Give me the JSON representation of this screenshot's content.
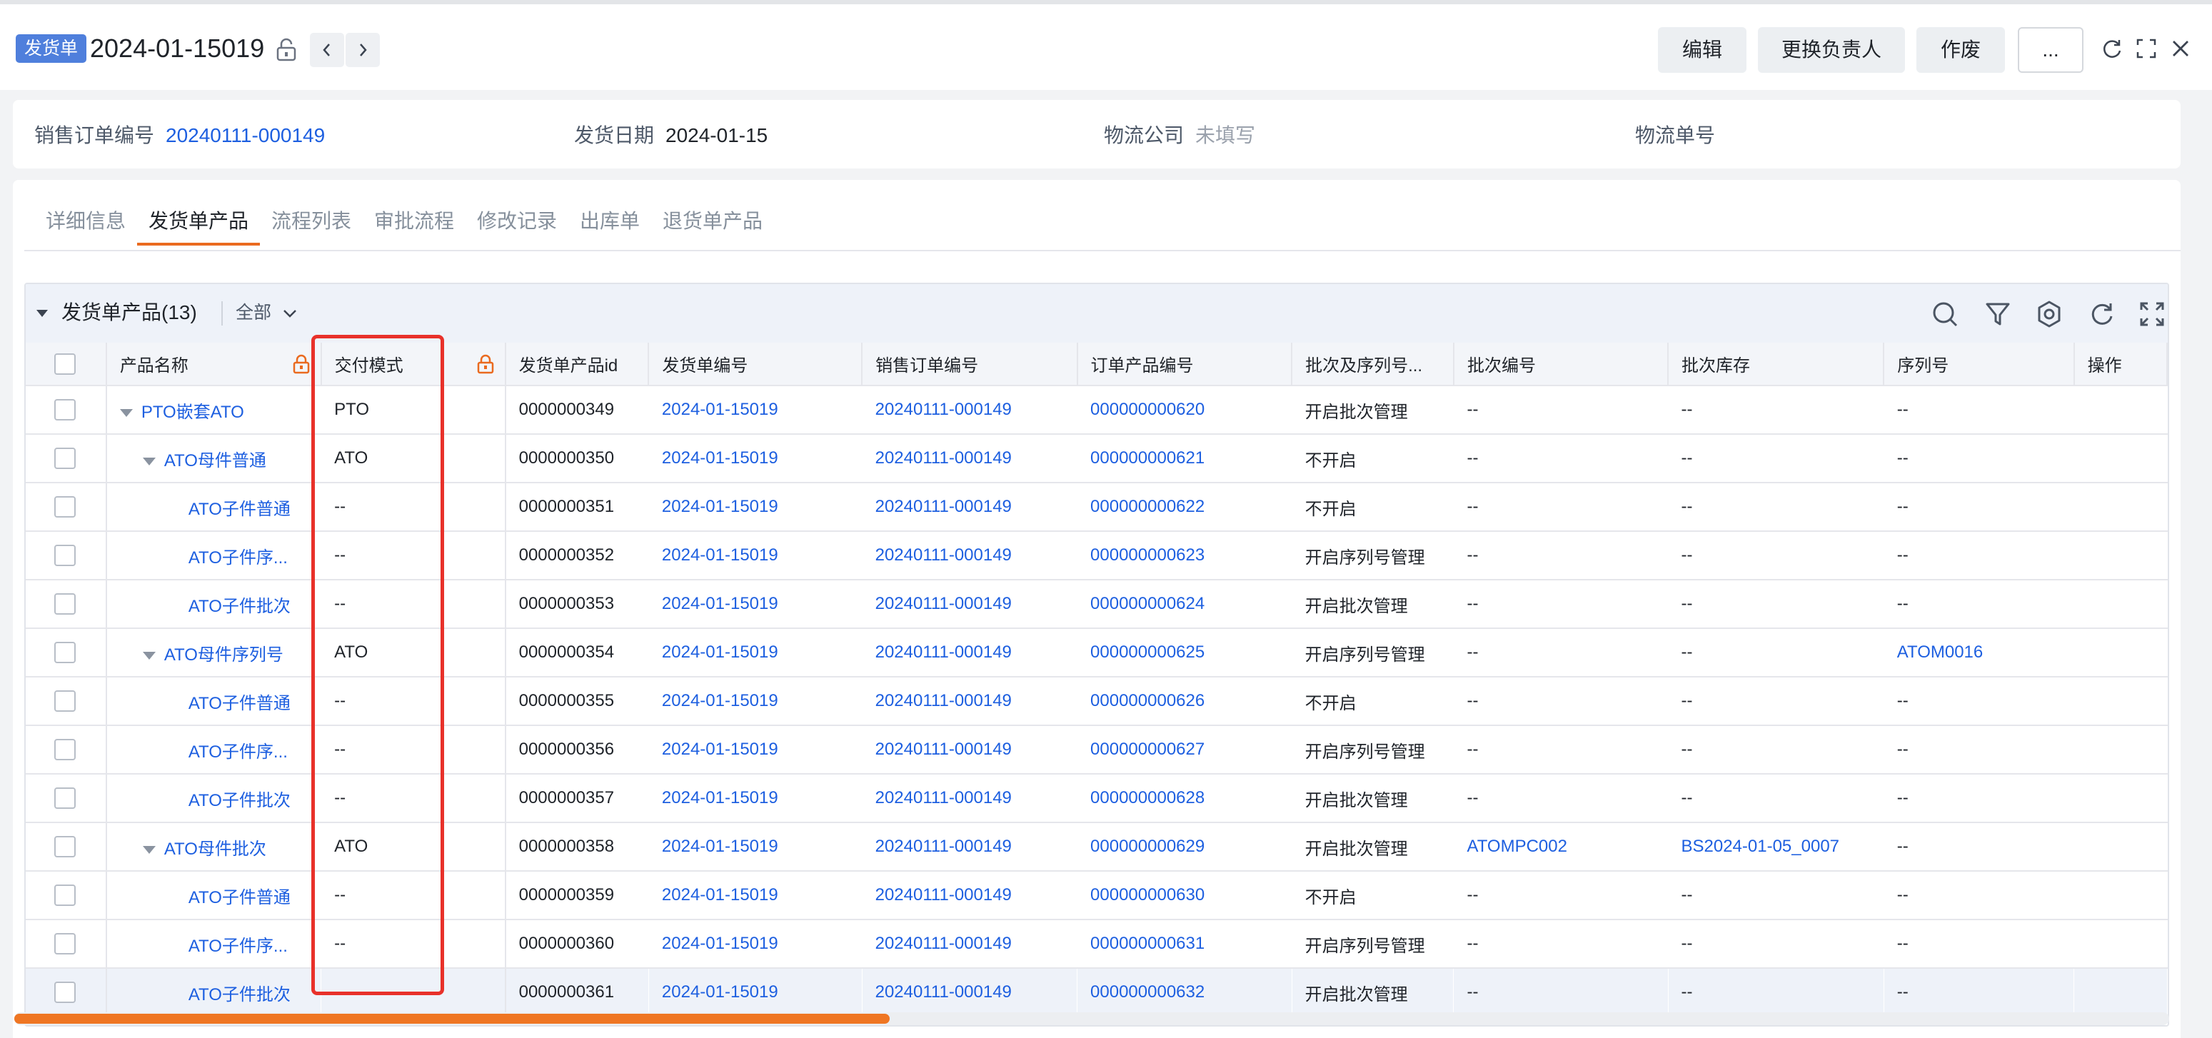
{
  "header": {
    "badge": "发货单",
    "title": "2024-01-15019",
    "actions": {
      "edit": "编辑",
      "change_owner": "更换负责人",
      "void": "作废",
      "more": "..."
    }
  },
  "info": [
    {
      "label": "销售订单编号",
      "value": "20240111-000149",
      "kind": "link"
    },
    {
      "label": "发货日期",
      "value": "2024-01-15",
      "kind": "text"
    },
    {
      "label": "物流公司",
      "value": "未填写",
      "kind": "muted"
    },
    {
      "label": "物流单号",
      "value": "",
      "kind": "text"
    }
  ],
  "tabs": [
    "详细信息",
    "发货单产品",
    "流程列表",
    "审批流程",
    "修改记录",
    "出库单",
    "退货单产品"
  ],
  "active_tab": "发货单产品",
  "grid": {
    "title": "发货单产品(13)",
    "filter": "全部",
    "columns": [
      "产品名称",
      "交付模式",
      "发货单产品id",
      "发货单编号",
      "销售订单编号",
      "订单产品编号",
      "批次及序列号...",
      "批次编号",
      "批次库存",
      "序列号",
      "操作"
    ],
    "rows": [
      {
        "name": "PTO嵌套ATO",
        "level": 1,
        "mode": "PTO",
        "id": "0000000349",
        "ship": "2024-01-15019",
        "so": "20240111-000149",
        "op": "000000000620",
        "track": "开启批次管理",
        "batch": "--",
        "stock": "--",
        "serial": "--"
      },
      {
        "name": "ATO母件普通",
        "level": 2,
        "mode": "ATO",
        "id": "0000000350",
        "ship": "2024-01-15019",
        "so": "20240111-000149",
        "op": "000000000621",
        "track": "不开启",
        "batch": "--",
        "stock": "--",
        "serial": "--"
      },
      {
        "name": "ATO子件普通",
        "level": 3,
        "mode": "--",
        "id": "0000000351",
        "ship": "2024-01-15019",
        "so": "20240111-000149",
        "op": "000000000622",
        "track": "不开启",
        "batch": "--",
        "stock": "--",
        "serial": "--"
      },
      {
        "name": "ATO子件序...",
        "level": 3,
        "mode": "--",
        "id": "0000000352",
        "ship": "2024-01-15019",
        "so": "20240111-000149",
        "op": "000000000623",
        "track": "开启序列号管理",
        "batch": "--",
        "stock": "--",
        "serial": "--"
      },
      {
        "name": "ATO子件批次",
        "level": 3,
        "mode": "--",
        "id": "0000000353",
        "ship": "2024-01-15019",
        "so": "20240111-000149",
        "op": "000000000624",
        "track": "开启批次管理",
        "batch": "--",
        "stock": "--",
        "serial": "--"
      },
      {
        "name": "ATO母件序列号",
        "level": 2,
        "mode": "ATO",
        "id": "0000000354",
        "ship": "2024-01-15019",
        "so": "20240111-000149",
        "op": "000000000625",
        "track": "开启序列号管理",
        "batch": "--",
        "stock": "--",
        "serial": "ATOM0016"
      },
      {
        "name": "ATO子件普通",
        "level": 3,
        "mode": "--",
        "id": "0000000355",
        "ship": "2024-01-15019",
        "so": "20240111-000149",
        "op": "000000000626",
        "track": "不开启",
        "batch": "--",
        "stock": "--",
        "serial": "--"
      },
      {
        "name": "ATO子件序...",
        "level": 3,
        "mode": "--",
        "id": "0000000356",
        "ship": "2024-01-15019",
        "so": "20240111-000149",
        "op": "000000000627",
        "track": "开启序列号管理",
        "batch": "--",
        "stock": "--",
        "serial": "--"
      },
      {
        "name": "ATO子件批次",
        "level": 3,
        "mode": "--",
        "id": "0000000357",
        "ship": "2024-01-15019",
        "so": "20240111-000149",
        "op": "000000000628",
        "track": "开启批次管理",
        "batch": "--",
        "stock": "--",
        "serial": "--"
      },
      {
        "name": "ATO母件批次",
        "level": 2,
        "mode": "ATO",
        "id": "0000000358",
        "ship": "2024-01-15019",
        "so": "20240111-000149",
        "op": "000000000629",
        "track": "开启批次管理",
        "batch": "ATOMPC002",
        "stock": "BS2024-01-05_0007",
        "serial": "--"
      },
      {
        "name": "ATO子件普通",
        "level": 3,
        "mode": "--",
        "id": "0000000359",
        "ship": "2024-01-15019",
        "so": "20240111-000149",
        "op": "000000000630",
        "track": "不开启",
        "batch": "--",
        "stock": "--",
        "serial": "--"
      },
      {
        "name": "ATO子件序...",
        "level": 3,
        "mode": "--",
        "id": "0000000360",
        "ship": "2024-01-15019",
        "so": "20240111-000149",
        "op": "000000000631",
        "track": "开启序列号管理",
        "batch": "--",
        "stock": "--",
        "serial": "--"
      },
      {
        "name": "ATO子件批次",
        "level": 3,
        "mode": "--",
        "id": "0000000361",
        "ship": "2024-01-15019",
        "so": "20240111-000149",
        "op": "000000000632",
        "track": "开启批次管理",
        "batch": "--",
        "stock": "--",
        "serial": "--"
      }
    ]
  },
  "colors": {
    "accent": "#ea6a1f",
    "link": "#1d5fe0",
    "badge": "#4f7fdc",
    "highlight_box": "#e8312a"
  },
  "icons": [
    "lock-icon",
    "chevron-left-icon",
    "chevron-right-icon",
    "refresh-icon",
    "fullscreen-icon",
    "close-icon",
    "search-icon",
    "filter-icon",
    "settings-icon"
  ]
}
